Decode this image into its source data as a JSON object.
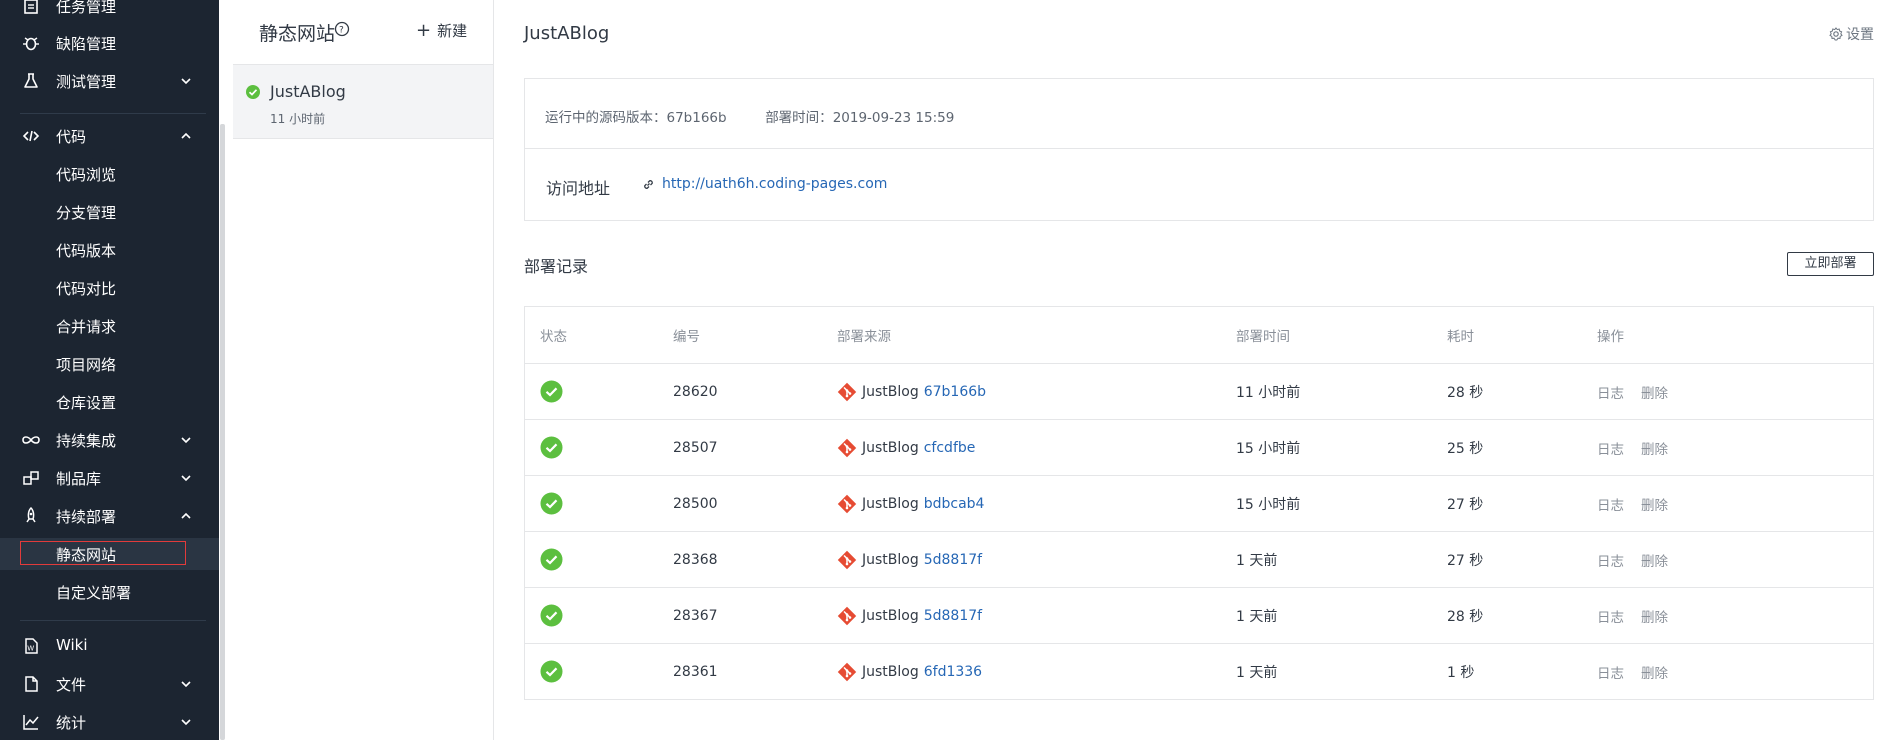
{
  "sidebar": {
    "items": [
      {
        "label": "任务管理",
        "icon": "task-icon",
        "chevron": "none"
      },
      {
        "label": "缺陷管理",
        "icon": "bug-icon",
        "chevron": "none"
      },
      {
        "label": "测试管理",
        "icon": "flask-icon",
        "chevron": "down"
      },
      {
        "label": "代码",
        "icon": "code-icon",
        "chevron": "up"
      },
      {
        "label": "代码浏览",
        "sub": true
      },
      {
        "label": "分支管理",
        "sub": true
      },
      {
        "label": "代码版本",
        "sub": true
      },
      {
        "label": "代码对比",
        "sub": true
      },
      {
        "label": "合并请求",
        "sub": true
      },
      {
        "label": "项目网络",
        "sub": true
      },
      {
        "label": "仓库设置",
        "sub": true
      },
      {
        "label": "持续集成",
        "icon": "infinity-icon",
        "chevron": "down"
      },
      {
        "label": "制品库",
        "icon": "package-icon",
        "chevron": "down"
      },
      {
        "label": "持续部署",
        "icon": "rocket-icon",
        "chevron": "up"
      },
      {
        "label": "静态网站",
        "sub": true,
        "active": true
      },
      {
        "label": "自定义部署",
        "sub": true
      },
      {
        "label": "Wiki",
        "icon": "wiki-icon",
        "chevron": "none"
      },
      {
        "label": "文件",
        "icon": "file-icon",
        "chevron": "down"
      },
      {
        "label": "统计",
        "icon": "chart-icon",
        "chevron": "down"
      }
    ]
  },
  "site_panel": {
    "title": "静态网站",
    "new_label": "新建",
    "site": {
      "name": "JustABlog",
      "updated": "11 小时前"
    }
  },
  "main": {
    "title": "JustABlog",
    "settings_label": "设置",
    "info": {
      "version_label": "运行中的源码版本：",
      "version_value": "67b166b",
      "deploy_time_label": "部署时间：",
      "deploy_time_value": "2019-09-23 15:59",
      "access_label": "访问地址",
      "access_url": "http://uath6h.coding-pages.com"
    },
    "records": {
      "title": "部署记录",
      "deploy_now_label": "立即部署",
      "columns": [
        "状态",
        "编号",
        "部署来源",
        "部署时间",
        "耗时",
        "操作"
      ],
      "rows": [
        {
          "status": "success",
          "id": "28620",
          "repo": "JustBlog",
          "commit": "67b166b",
          "time": "11 小时前",
          "duration": "28 秒",
          "ops": [
            "日志",
            "删除"
          ]
        },
        {
          "status": "success",
          "id": "28507",
          "repo": "JustBlog",
          "commit": "cfcdfbe",
          "time": "15 小时前",
          "duration": "25 秒",
          "ops": [
            "日志",
            "删除"
          ]
        },
        {
          "status": "success",
          "id": "28500",
          "repo": "JustBlog",
          "commit": "bdbcab4",
          "time": "15 小时前",
          "duration": "27 秒",
          "ops": [
            "日志",
            "删除"
          ]
        },
        {
          "status": "success",
          "id": "28368",
          "repo": "JustBlog",
          "commit": "5d8817f",
          "time": "1 天前",
          "duration": "27 秒",
          "ops": [
            "日志",
            "删除"
          ]
        },
        {
          "status": "success",
          "id": "28367",
          "repo": "JustBlog",
          "commit": "5d8817f",
          "time": "1 天前",
          "duration": "28 秒",
          "ops": [
            "日志",
            "删除"
          ]
        },
        {
          "status": "success",
          "id": "28361",
          "repo": "JustBlog",
          "commit": "6fd1336",
          "time": "1 天前",
          "duration": "1 秒",
          "ops": [
            "日志",
            "删除"
          ]
        }
      ]
    }
  },
  "colors": {
    "sidebar_bg": "#1c2531",
    "success": "#5cbf3f",
    "link": "#2667b5",
    "git_brand": "#e64b33",
    "active_outline": "#e23b3b"
  }
}
